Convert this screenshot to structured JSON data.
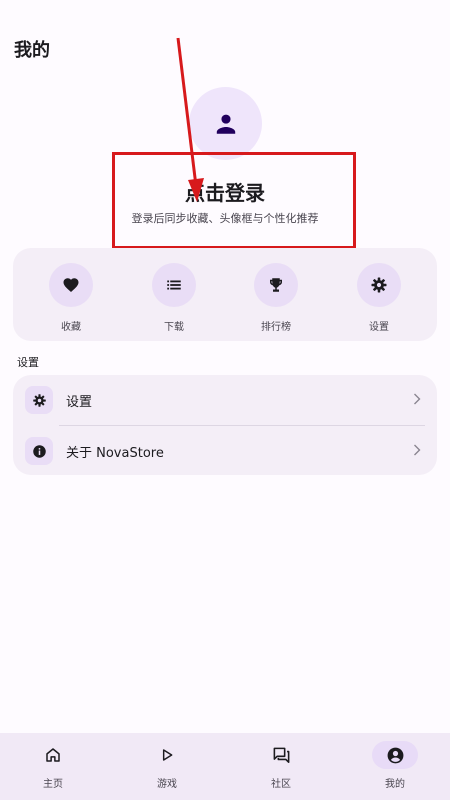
{
  "header": {
    "title": "我的"
  },
  "profile": {
    "login_title": "点击登录",
    "login_subtitle": "登录后同步收藏、头像框与个性化推荐",
    "avatar_icon": "person-icon"
  },
  "quick_actions": [
    {
      "label": "收藏",
      "icon": "heart-icon"
    },
    {
      "label": "下载",
      "icon": "list-icon"
    },
    {
      "label": "排行榜",
      "icon": "trophy-icon"
    },
    {
      "label": "设置",
      "icon": "gear-icon"
    }
  ],
  "settings_section": {
    "label": "设置",
    "items": [
      {
        "label": "设置",
        "icon": "gear-icon"
      },
      {
        "label": "关于 NovaStore",
        "icon": "info-icon"
      }
    ]
  },
  "bottom_nav": [
    {
      "label": "主页",
      "icon": "home-icon",
      "active": false
    },
    {
      "label": "游戏",
      "icon": "play-icon",
      "active": false
    },
    {
      "label": "社区",
      "icon": "forum-icon",
      "active": false
    },
    {
      "label": "我的",
      "icon": "account-icon",
      "active": true
    }
  ],
  "colors": {
    "background": "#fefbff",
    "card": "#f4eef7",
    "icon_bg": "#e9ddf6",
    "icon": "#1c1b1f",
    "avatar_icon": "#21005d",
    "annotation": "#d7191c"
  }
}
